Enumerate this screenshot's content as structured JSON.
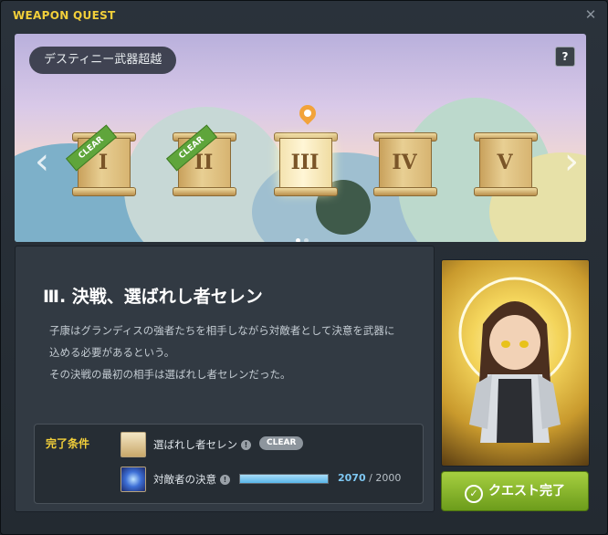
{
  "window": {
    "title": "WEAPON QUEST",
    "close_icon": "close-icon"
  },
  "banner": {
    "stage_name": "デスティニー武器超越",
    "help_label": "?",
    "chapters": [
      {
        "label": "I",
        "status": "CLEAR"
      },
      {
        "label": "II",
        "status": "CLEAR"
      },
      {
        "label": "III",
        "status": ""
      },
      {
        "label": "IV",
        "status": ""
      },
      {
        "label": "V",
        "status": ""
      }
    ],
    "page_dots": 2
  },
  "quest": {
    "title": "Ⅲ. 決戦、選ばれし者セレン",
    "description": [
      "子康はグランディスの強者たちを相手しながら対敵者として決意を武器に",
      "込める必要があるという。",
      "その決戦の最初の相手は選ばれし者セレンだった。"
    ],
    "conditions_label": "完了条件",
    "conditions": [
      {
        "name": "選ばれし者セレン",
        "badge": "CLEAR"
      },
      {
        "name": "対敵者の決意",
        "current": "2070",
        "separator": "/",
        "total": "2000",
        "progress": 1.0
      }
    ]
  },
  "actions": {
    "complete_label": "クエスト完了"
  },
  "colors": {
    "accent_yellow": "#f2cf3a",
    "button_green": "#8bb82e",
    "progress_blue": "#7ec8f3"
  }
}
